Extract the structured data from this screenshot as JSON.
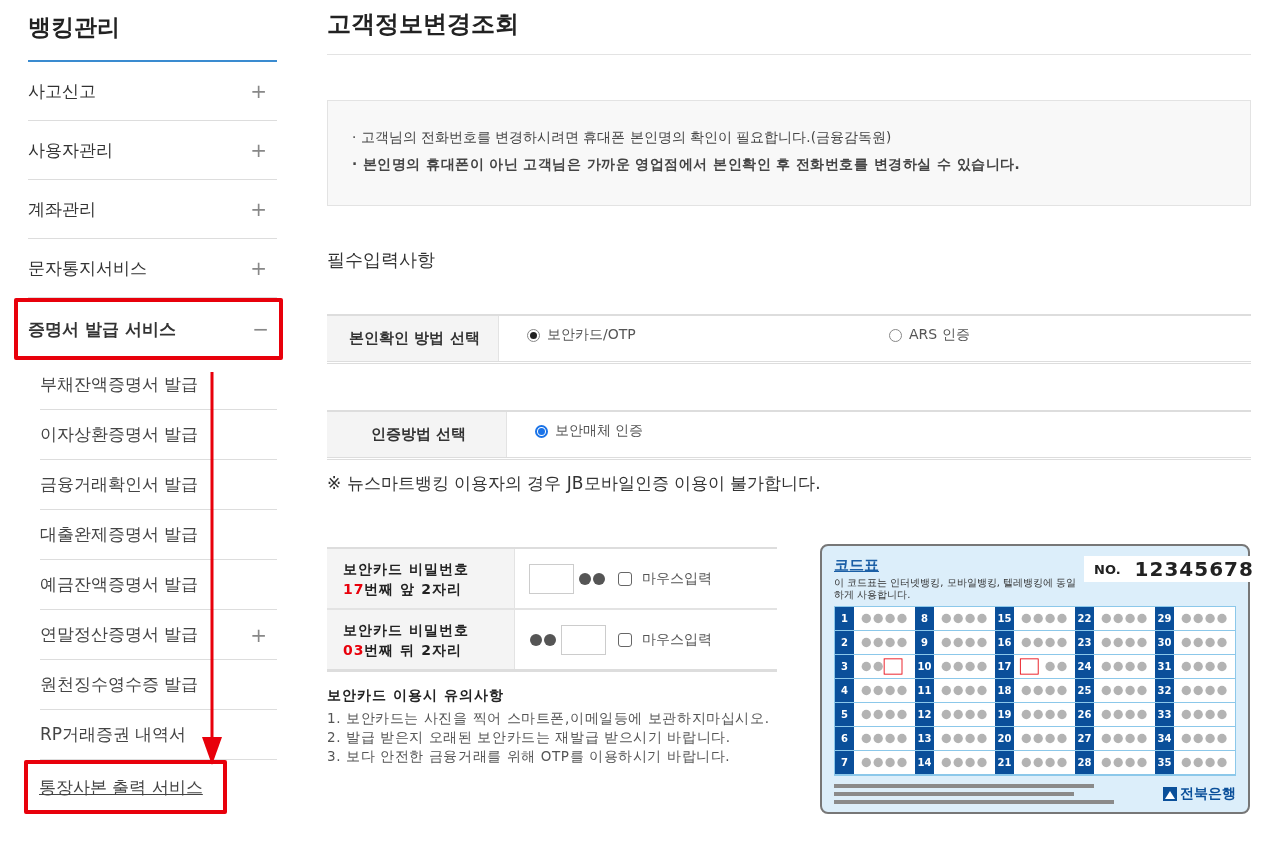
{
  "sidebar": {
    "title": "뱅킹관리",
    "items": [
      {
        "label": "사고신고",
        "toggle": "+",
        "expanded": false,
        "highlighted": false
      },
      {
        "label": "사용자관리",
        "toggle": "+",
        "expanded": false,
        "highlighted": false
      },
      {
        "label": "계좌관리",
        "toggle": "+",
        "expanded": false,
        "highlighted": false
      },
      {
        "label": "문자통지서비스",
        "toggle": "+",
        "expanded": false,
        "highlighted": false
      },
      {
        "label": "증명서 발급 서비스",
        "toggle": "−",
        "expanded": true,
        "highlighted": true,
        "children": [
          {
            "label": "부채잔액증명서 발급",
            "highlighted": false,
            "underlined": false
          },
          {
            "label": "이자상환증명서 발급",
            "highlighted": false,
            "underlined": false
          },
          {
            "label": "금융거래확인서 발급",
            "highlighted": false,
            "underlined": false
          },
          {
            "label": "대출완제증명서 발급",
            "highlighted": false,
            "underlined": false
          },
          {
            "label": "예금잔액증명서 발급",
            "highlighted": false,
            "underlined": false
          },
          {
            "label": "연말정산증명서 발급",
            "toggle": "+",
            "highlighted": false,
            "underlined": false
          },
          {
            "label": "원천징수영수증 발급",
            "highlighted": false,
            "underlined": false
          },
          {
            "label": "RP거래증권 내역서",
            "highlighted": false,
            "underlined": false
          },
          {
            "label": "통장사본 출력 서비스",
            "highlighted": true,
            "underlined": true
          }
        ]
      }
    ]
  },
  "main": {
    "title": "고객정보변경조회",
    "notices": [
      {
        "bullet": "·",
        "text": "고객님의 전화번호를 변경하시려면 휴대폰 본인명의 확인이 필요합니다.(금융감독원)",
        "bold": false
      },
      {
        "bullet": "·",
        "text": "본인명의 휴대폰이 아닌 고객님은 가까운 영업점에서 본인확인 후 전화번호를 변경하실 수 있습니다.",
        "bold": true
      }
    ],
    "section_title": "필수입력사항",
    "choices": [
      {
        "label": "본인확인 방법 선택",
        "kind": "classic",
        "options": [
          {
            "label": "보안카드/OTP",
            "selected": true
          },
          {
            "label": "ARS 인증",
            "selected": false
          }
        ]
      },
      {
        "label": "인증방법 선택",
        "kind": "blue",
        "options": [
          {
            "label": "보안매체 인증",
            "selected": true
          }
        ]
      }
    ],
    "note": "※ 뉴스마트뱅킹 이용자의 경우 JB모바일인증 이용이 불가합니다.",
    "card_inputs": [
      {
        "label": "보안카드 비밀번호",
        "ordinal": "17",
        "label_rest": "번째 앞 2자리",
        "kind": "front",
        "mouse_label": "마우스입력",
        "checked": false
      },
      {
        "label": "보안카드 비밀번호",
        "ordinal": "03",
        "label_rest": "번째 뒤 2자리",
        "kind": "back",
        "mouse_label": "마우스입력",
        "checked": false
      }
    ],
    "caution": {
      "title": "보안카드 이용시 유의사항",
      "lines": [
        "1. 보안카드는 사진을 찍어 스마트폰,이메일등에 보관하지마십시오.",
        "2. 발급 받은지 오래된 보안카드는 재발급 받으시기 바랍니다.",
        "3. 보다 안전한 금융거래를 위해 OTP를 이용하시기 바랍니다."
      ]
    },
    "code_card": {
      "title": "코드표",
      "subtitle": "이 코드표는 인터넷뱅킹, 모바일뱅킹, 텔레뱅킹에 동일하게 사용합니다.",
      "no_label": "NO.",
      "number": "12345678",
      "bank": "전북은행",
      "cells": [
        {
          "number": "1"
        },
        {
          "number": "2"
        },
        {
          "number": "3",
          "kind": "back"
        },
        {
          "number": "4"
        },
        {
          "number": "5"
        },
        {
          "number": "6"
        },
        {
          "number": "7"
        },
        {
          "number": "8"
        },
        {
          "number": "9"
        },
        {
          "number": "10"
        },
        {
          "number": "11"
        },
        {
          "number": "12"
        },
        {
          "number": "13"
        },
        {
          "number": "14"
        },
        {
          "number": "15"
        },
        {
          "number": "16"
        },
        {
          "number": "17",
          "kind": "front"
        },
        {
          "number": "18"
        },
        {
          "number": "19"
        },
        {
          "number": "20"
        },
        {
          "number": "21"
        },
        {
          "number": "22"
        },
        {
          "number": "23"
        },
        {
          "number": "24"
        },
        {
          "number": "25"
        },
        {
          "number": "26"
        },
        {
          "number": "27"
        },
        {
          "number": "28"
        },
        {
          "number": "29"
        },
        {
          "number": "30"
        },
        {
          "number": "31"
        },
        {
          "number": "32"
        },
        {
          "number": "33"
        },
        {
          "number": "34"
        },
        {
          "number": "35"
        }
      ]
    }
  }
}
